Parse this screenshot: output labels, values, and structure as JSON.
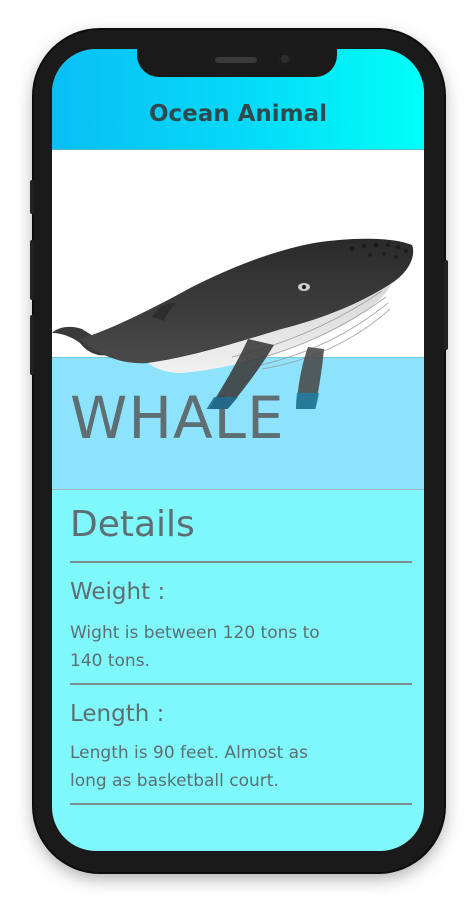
{
  "header": {
    "title": "Ocean Animal"
  },
  "animal": {
    "name": "WHALE",
    "image_icon": "humpback-whale-illustration"
  },
  "details": {
    "title": "Details",
    "sections": [
      {
        "heading": "Weight :",
        "text": "Wight is between 120 tons to 140 tons."
      },
      {
        "heading": "Length :",
        "text": "Length is 90 feet. Almost as long as basketball court."
      }
    ]
  },
  "colors": {
    "header_gradient_start": "#09bff6",
    "header_gradient_end": "#00fff8",
    "name_band": "#8ce3fb",
    "details_background": "#7ff8fb",
    "text": "#5e6e72"
  }
}
